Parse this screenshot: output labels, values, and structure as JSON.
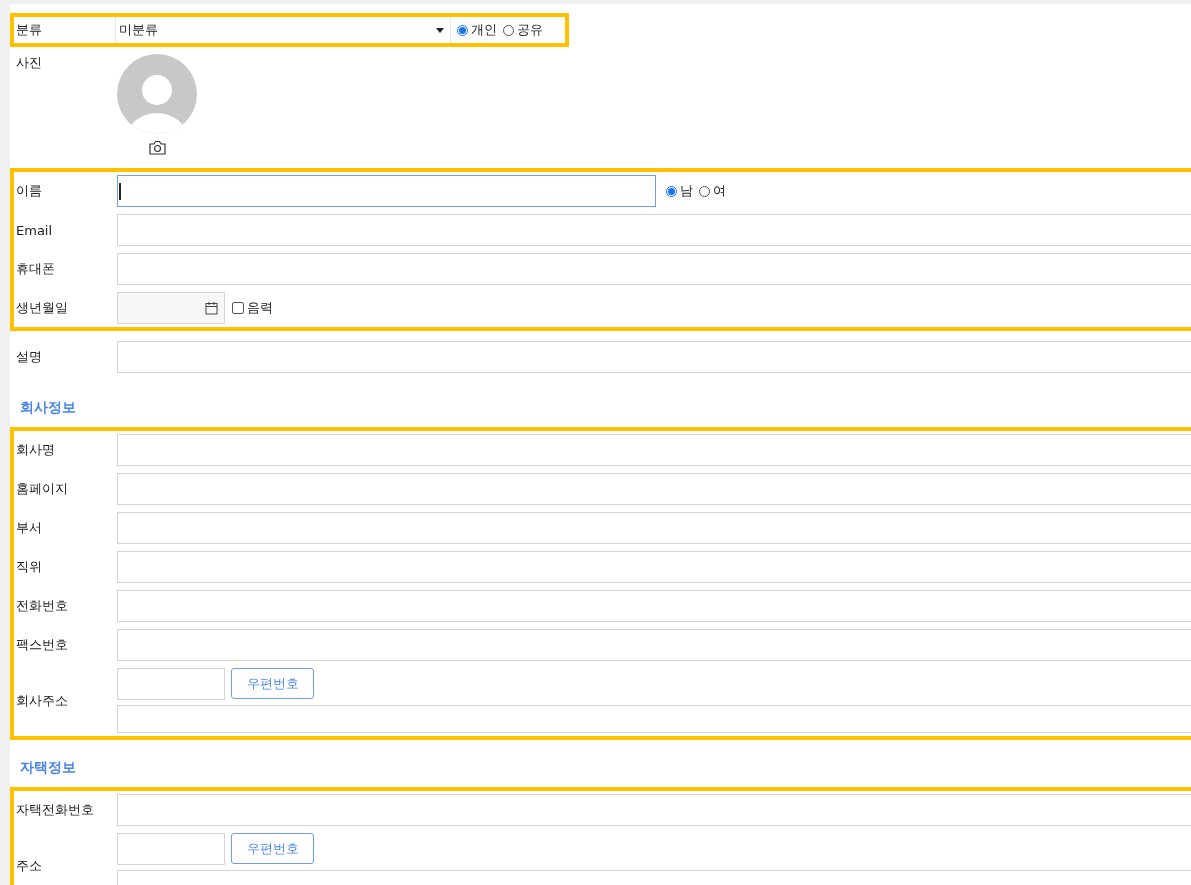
{
  "blocks": [
    {
      "kind": "group",
      "highlighted": true,
      "rows": [
        {
          "kind": "select",
          "label": "분류",
          "value": "미분류",
          "options": [
            {
              "label": "개인",
              "selected": true
            },
            {
              "label": "공유",
              "selected": false
            }
          ]
        }
      ]
    },
    {
      "kind": "group",
      "highlighted": false,
      "rows": [
        {
          "kind": "photo",
          "label": "사진"
        }
      ]
    },
    {
      "kind": "group",
      "highlighted": true,
      "rows": [
        {
          "kind": "text",
          "label": "이름",
          "focused": true,
          "options": [
            {
              "label": "남",
              "selected": true
            },
            {
              "label": "여",
              "selected": false
            }
          ]
        },
        {
          "kind": "text",
          "label": "Email",
          "focused": false
        },
        {
          "kind": "text",
          "label": "휴대폰",
          "focused": false
        },
        {
          "kind": "date",
          "label": "생년월일",
          "checkbox": {
            "label": "음력",
            "checked": false
          }
        }
      ]
    },
    {
      "kind": "group",
      "highlighted": false,
      "rows": [
        {
          "kind": "text",
          "label": "설명",
          "focused": false
        }
      ]
    },
    {
      "kind": "heading",
      "text": "회사정보"
    },
    {
      "kind": "group",
      "highlighted": true,
      "rows": [
        {
          "kind": "text",
          "label": "회사명",
          "focused": false
        },
        {
          "kind": "text",
          "label": "홈페이지",
          "focused": false
        },
        {
          "kind": "text",
          "label": "부서",
          "focused": false
        },
        {
          "kind": "text",
          "label": "직위",
          "focused": false
        },
        {
          "kind": "text",
          "label": "전화번호",
          "focused": false
        },
        {
          "kind": "text",
          "label": "팩스번호",
          "focused": false
        },
        {
          "kind": "address",
          "label": "회사주소",
          "button": "우편번호"
        }
      ]
    },
    {
      "kind": "heading",
      "text": "자택정보"
    },
    {
      "kind": "group",
      "highlighted": true,
      "rows": [
        {
          "kind": "text",
          "label": "자택전화번호",
          "focused": false
        },
        {
          "kind": "address",
          "label": "주소",
          "button": "우편번호"
        }
      ]
    }
  ]
}
